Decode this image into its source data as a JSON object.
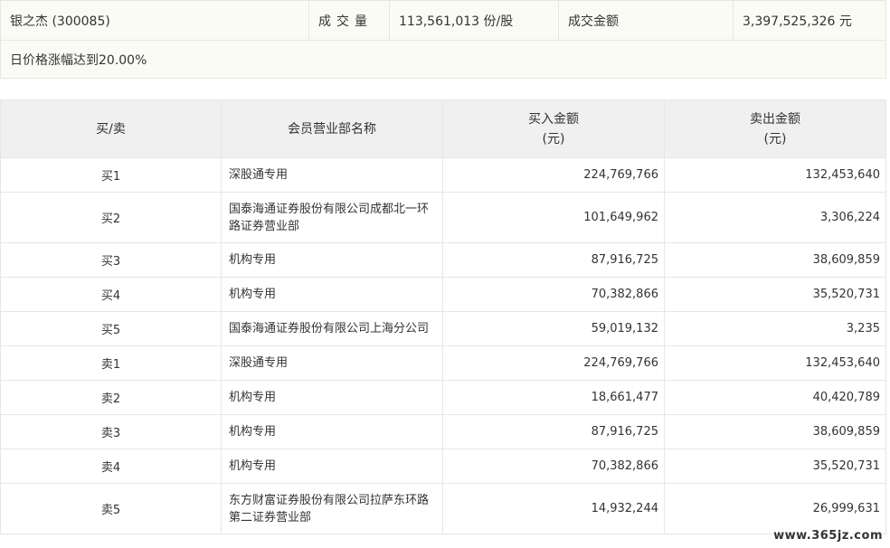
{
  "summary": {
    "stock": "银之杰 (300085)",
    "vol_label": "成交量",
    "vol_value": "113,561,013 份/股",
    "amount_label": "成交金额",
    "amount_value": "3,397,525,326 元",
    "reason": "日价格涨幅达到20.00%"
  },
  "table": {
    "headers": {
      "side": "买/卖",
      "member": "会员营业部名称",
      "buy_line1": "买入金额",
      "buy_line2": "(元)",
      "sell_line1": "卖出金额",
      "sell_line2": "(元)"
    },
    "rows": [
      {
        "side": "买1",
        "name": "深股通专用",
        "name2": "",
        "buy": "224,769,766",
        "sell": "132,453,640"
      },
      {
        "side": "买2",
        "name": "国泰海通证券股份有限公司成都北一环",
        "name2": "路证券营业部",
        "buy": "101,649,962",
        "sell": "3,306,224"
      },
      {
        "side": "买3",
        "name": "机构专用",
        "name2": "",
        "buy": "87,916,725",
        "sell": "38,609,859"
      },
      {
        "side": "买4",
        "name": "机构专用",
        "name2": "",
        "buy": "70,382,866",
        "sell": "35,520,731"
      },
      {
        "side": "买5",
        "name": "国泰海通证券股份有限公司上海分公司",
        "name2": "",
        "buy": "59,019,132",
        "sell": "3,235"
      },
      {
        "side": "卖1",
        "name": "深股通专用",
        "name2": "",
        "buy": "224,769,766",
        "sell": "132,453,640"
      },
      {
        "side": "卖2",
        "name": "机构专用",
        "name2": "",
        "buy": "18,661,477",
        "sell": "40,420,789"
      },
      {
        "side": "卖3",
        "name": "机构专用",
        "name2": "",
        "buy": "87,916,725",
        "sell": "38,609,859"
      },
      {
        "side": "卖4",
        "name": "机构专用",
        "name2": "",
        "buy": "70,382,866",
        "sell": "35,520,731"
      },
      {
        "side": "卖5",
        "name": "东方财富证券股份有限公司拉萨东环路",
        "name2": "第二证券营业部",
        "buy": "14,932,244",
        "sell": "26,999,631"
      }
    ]
  },
  "watermark": "www.365jz.com"
}
